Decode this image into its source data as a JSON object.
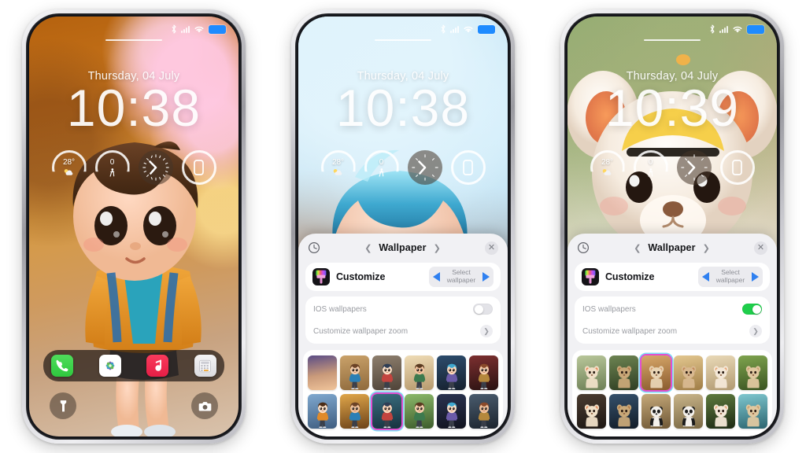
{
  "meta": {
    "background_color": "#ffffff",
    "accent_blue": "#2f80f0",
    "toggle_on_color": "#1fce4b",
    "sheet_bg": "#f1f1f4"
  },
  "phones": [
    {
      "id": "phone-1",
      "name": "phone-left",
      "lockscreen": {
        "date": "Thursday, 04 July",
        "time": "10:38",
        "status_bar": {
          "bluetooth_icon": "bluetooth-icon",
          "signal_icon": "cellular-signal-icon",
          "wifi_icon": "wifi-icon",
          "battery_icon": "battery-icon",
          "battery_color": "#1e8bff"
        },
        "widgets": [
          {
            "name": "weather-widget",
            "value": "28°",
            "sub_icon": "partly-cloudy-icon"
          },
          {
            "name": "steps-widget",
            "value": "0",
            "sub_icon": "walking-person-icon"
          },
          {
            "name": "analog-clock-widget",
            "value": "",
            "sub_icon": "analog-clock-icon"
          },
          {
            "name": "device-battery-widget",
            "value": "",
            "sub_icon": "phone-outline-icon"
          }
        ]
      },
      "dock": {
        "apps": [
          {
            "name": "phone-app",
            "icon": "phone-handset-icon",
            "color": "#3ad04a"
          },
          {
            "name": "photos-app",
            "icon": "photos-flower-icon",
            "color": "#ffffff"
          },
          {
            "name": "music-app",
            "icon": "music-note-icon",
            "color": "#ee2148"
          },
          {
            "name": "calculator-app",
            "icon": "calculator-icon",
            "color": "#e9e9ed"
          }
        ]
      },
      "quick_actions": [
        {
          "name": "flashlight-button",
          "icon": "flashlight-icon"
        },
        {
          "name": "camera-button",
          "icon": "camera-icon"
        }
      ],
      "sheet_visible": false,
      "wallpaper_desc": "autumn-boy-wallpaper"
    },
    {
      "id": "phone-2",
      "name": "phone-middle",
      "lockscreen": {
        "date": "Thursday, 04 July",
        "time": "10:38",
        "status_bar": {
          "bluetooth_icon": "bluetooth-icon",
          "signal_icon": "cellular-signal-icon",
          "wifi_icon": "wifi-icon",
          "battery_icon": "battery-icon",
          "battery_color": "#1e8bff"
        },
        "widgets": [
          {
            "name": "weather-widget",
            "value": "28°",
            "sub_icon": "partly-cloudy-icon"
          },
          {
            "name": "steps-widget",
            "value": "0",
            "sub_icon": "walking-person-icon"
          },
          {
            "name": "analog-clock-widget",
            "value": "",
            "sub_icon": "analog-clock-icon"
          },
          {
            "name": "device-battery-widget",
            "value": "",
            "sub_icon": "phone-outline-icon"
          }
        ]
      },
      "sheet_visible": true,
      "wallpaper_desc": "ice-blue-boy-wallpaper",
      "sheet": {
        "history_icon": "history-clock-icon",
        "prev_icon": "chevron-left-icon",
        "title": "Wallpaper",
        "next_icon": "chevron-right-icon",
        "close_icon": "close-icon",
        "customize": {
          "icon": "paintbrush-icon",
          "label": "Customize",
          "prev_arrow_icon": "triangle-left-icon",
          "select_line1": "Select",
          "select_line2": "wallpaper",
          "next_arrow_icon": "triangle-right-icon"
        },
        "rows": [
          {
            "name": "ios-wallpapers-row",
            "label": "IOS wallpapers",
            "control": "toggle",
            "value": "off"
          },
          {
            "name": "customize-wallpaper-zoom-row",
            "label": "Customize wallpaper zoom",
            "control": "arrow",
            "value": ""
          }
        ],
        "thumbnails": [
          {
            "name": "wallpaper-thumb-1",
            "selected": false,
            "bg": "linear-gradient(170deg,#5a4c86,#c99a7a 55%,#f0c49a)",
            "fig": "none"
          },
          {
            "name": "wallpaper-thumb-2",
            "selected": false,
            "bg": "linear-gradient(170deg,#caa26a,#8f6a3c)",
            "fig": "boy"
          },
          {
            "name": "wallpaper-thumb-3",
            "selected": false,
            "bg": "linear-gradient(170deg,#8e7f6e,#4f4338)",
            "fig": "boy"
          },
          {
            "name": "wallpaper-thumb-4",
            "selected": false,
            "bg": "linear-gradient(170deg,#efdcb6,#b79a6e)",
            "fig": "boy"
          },
          {
            "name": "wallpaper-thumb-5",
            "selected": false,
            "bg": "linear-gradient(170deg,#2d4d6d,#16202e)",
            "fig": "boy"
          },
          {
            "name": "wallpaper-thumb-6",
            "selected": false,
            "bg": "linear-gradient(170deg,#7d3030,#2a1212)",
            "fig": "boy"
          },
          {
            "name": "wallpaper-thumb-7",
            "selected": false,
            "bg": "linear-gradient(170deg,#7fa8cf,#3f5d80)",
            "fig": "boy"
          },
          {
            "name": "wallpaper-thumb-8",
            "selected": false,
            "bg": "linear-gradient(170deg,#e0a64a,#6d4318)",
            "fig": "boy"
          },
          {
            "name": "wallpaper-thumb-9",
            "selected": true,
            "bg": "linear-gradient(170deg,#3a6e7f,#16323f)",
            "fig": "boy"
          },
          {
            "name": "wallpaper-thumb-10",
            "selected": false,
            "bg": "linear-gradient(170deg,#8cb96a,#3d5c2c)",
            "fig": "boy"
          },
          {
            "name": "wallpaper-thumb-11",
            "selected": false,
            "bg": "linear-gradient(170deg,#2a3350,#11131f)",
            "fig": "boy"
          },
          {
            "name": "wallpaper-thumb-12",
            "selected": false,
            "bg": "linear-gradient(170deg,#4a5c6e,#1c242e)",
            "fig": "boy"
          }
        ]
      }
    },
    {
      "id": "phone-3",
      "name": "phone-right",
      "lockscreen": {
        "date": "Thursday, 04 July",
        "time": "10:39",
        "status_bar": {
          "bluetooth_icon": "bluetooth-icon",
          "signal_icon": "cellular-signal-icon",
          "wifi_icon": "wifi-icon",
          "battery_icon": "battery-icon",
          "battery_color": "#1e8bff"
        },
        "widgets": [
          {
            "name": "weather-widget",
            "value": "28°",
            "sub_icon": "partly-cloudy-icon"
          },
          {
            "name": "steps-widget",
            "value": "0",
            "sub_icon": "walking-person-icon"
          },
          {
            "name": "analog-clock-widget",
            "value": "",
            "sub_icon": "analog-clock-icon"
          },
          {
            "name": "device-battery-widget",
            "value": "",
            "sub_icon": "phone-outline-icon"
          }
        ]
      },
      "sheet_visible": true,
      "wallpaper_desc": "plush-mouse-wallpaper",
      "sheet": {
        "history_icon": "history-clock-icon",
        "prev_icon": "chevron-left-icon",
        "title": "Wallpaper",
        "next_icon": "chevron-right-icon",
        "close_icon": "close-icon",
        "customize": {
          "icon": "paintbrush-icon",
          "label": "Customize",
          "prev_arrow_icon": "triangle-left-icon",
          "select_line1": "Select",
          "select_line2": "wallpaper",
          "next_arrow_icon": "triangle-right-icon"
        },
        "rows": [
          {
            "name": "ios-wallpapers-row",
            "label": "IOS wallpapers",
            "control": "toggle",
            "value": "on"
          },
          {
            "name": "customize-wallpaper-zoom-row",
            "label": "Customize wallpaper zoom",
            "control": "arrow",
            "value": ""
          }
        ],
        "thumbnails": [
          {
            "name": "wallpaper-thumb-1",
            "selected": false,
            "bg": "linear-gradient(170deg,#b9c79a,#6d7f56)",
            "fig": "animal"
          },
          {
            "name": "wallpaper-thumb-2",
            "selected": false,
            "bg": "linear-gradient(170deg,#6d8452,#2f3e22)",
            "fig": "animal"
          },
          {
            "name": "wallpaper-thumb-3",
            "selected": true,
            "bg": "linear-gradient(170deg,#d8a86a,#8a5b2e)",
            "fig": "animal"
          },
          {
            "name": "wallpaper-thumb-4",
            "selected": false,
            "bg": "linear-gradient(170deg,#e3c78f,#a07d46)",
            "fig": "animal"
          },
          {
            "name": "wallpaper-thumb-5",
            "selected": false,
            "bg": "linear-gradient(170deg,#e9d9b7,#b29a72)",
            "fig": "animal"
          },
          {
            "name": "wallpaper-thumb-6",
            "selected": false,
            "bg": "linear-gradient(170deg,#7fa44e,#3a5421)",
            "fig": "animal"
          },
          {
            "name": "wallpaper-thumb-7",
            "selected": false,
            "bg": "linear-gradient(170deg,#4a3b30,#1d1713)",
            "fig": "animal"
          },
          {
            "name": "wallpaper-thumb-8",
            "selected": false,
            "bg": "linear-gradient(170deg,#35506b,#121c28)",
            "fig": "animal"
          },
          {
            "name": "wallpaper-thumb-9",
            "selected": false,
            "bg": "linear-gradient(170deg,#c6a97a,#6f5836)",
            "fig": "panda"
          },
          {
            "name": "wallpaper-thumb-10",
            "selected": false,
            "bg": "linear-gradient(170deg,#c9b58a,#7a6844)",
            "fig": "panda"
          },
          {
            "name": "wallpaper-thumb-11",
            "selected": false,
            "bg": "linear-gradient(170deg,#5e7a3e,#1e2a14)",
            "fig": "animal"
          },
          {
            "name": "wallpaper-thumb-12",
            "selected": false,
            "bg": "linear-gradient(170deg,#7fc7cf,#2c6570)",
            "fig": "animal"
          }
        ]
      }
    }
  ]
}
